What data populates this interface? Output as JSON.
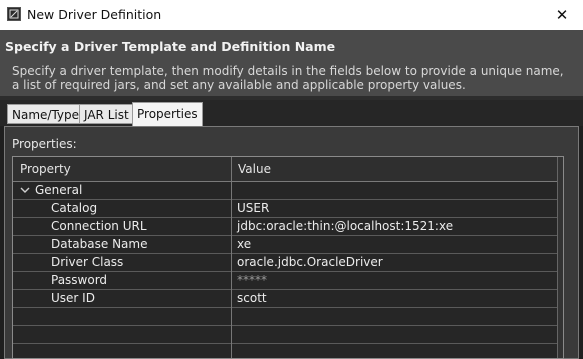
{
  "window": {
    "title": "New Driver Definition",
    "close_glyph": "✕",
    "icon": "app-icon"
  },
  "header": {
    "title": "Specify a Driver Template and Definition Name",
    "description": "Specify a driver template, then modify details in the fields below to provide a unique name, a list of required jars, and set any available and applicable property values."
  },
  "tabs": [
    {
      "label": "Name/Type",
      "selected": false
    },
    {
      "label": "JAR List",
      "selected": false
    },
    {
      "label": "Properties",
      "selected": true
    }
  ],
  "properties": {
    "section_label": "Properties:",
    "columns": [
      "Property",
      "Value"
    ],
    "group": "General",
    "rows": [
      {
        "property": "Catalog",
        "value": "USER"
      },
      {
        "property": "Connection URL",
        "value": "jdbc:oracle:thin:@localhost:1521:xe"
      },
      {
        "property": "Database Name",
        "value": "xe"
      },
      {
        "property": "Driver Class",
        "value": "oracle.jdbc.OracleDriver"
      },
      {
        "property": "Password",
        "value": "*****"
      },
      {
        "property": "User ID",
        "value": "scott"
      }
    ]
  }
}
